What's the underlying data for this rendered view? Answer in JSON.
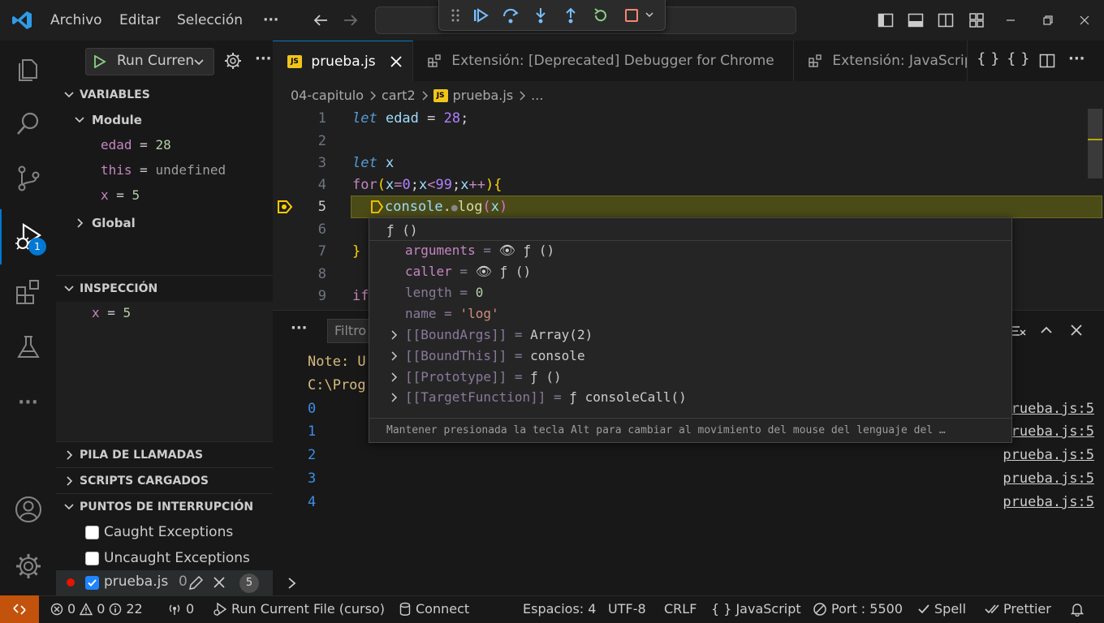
{
  "titlebar": {
    "menus": [
      "Archivo",
      "Editar",
      "Selección"
    ],
    "more": "···"
  },
  "activity": {
    "debug_badge": "1"
  },
  "sidebar": {
    "run_config": "Run Curren",
    "more": "···",
    "variables_title": "VARIABLES",
    "module_label": "Module",
    "vars": [
      {
        "name": "edad",
        "eq": " = ",
        "value": "28"
      },
      {
        "name": "this",
        "eq": " = ",
        "value": "undefined"
      },
      {
        "name": "x",
        "eq": " = ",
        "value": "5"
      }
    ],
    "global_label": "Global",
    "watch_title": "INSPECCIÓN",
    "watch": [
      {
        "name": "x",
        "eq": " = ",
        "value": "5"
      }
    ],
    "callstack_title": "PILA DE LLAMADAS",
    "scripts_title": "SCRIPTS CARGADOS",
    "breakpoints_title": "PUNTOS DE INTERRUPCIÓN",
    "breakpoints": [
      {
        "label": "Caught Exceptions",
        "checked": false
      },
      {
        "label": "Uncaught Exceptions",
        "checked": false
      }
    ],
    "bp_file": "prueba.js",
    "bp_file_num": "0",
    "bp_file_count": "5"
  },
  "tabs": [
    {
      "label": "prueba.js",
      "badge": "JS",
      "active": true
    },
    {
      "label": "Extensión: [Deprecated] Debugger for Chrome",
      "active": false
    },
    {
      "label": "Extensión: JavaScript",
      "active": false
    }
  ],
  "breadcrumb": [
    "04-capitulo",
    "cart2",
    "prueba.js",
    "..."
  ],
  "editor": {
    "line_numbers": [
      "1",
      "2",
      "3",
      "4",
      "5",
      "6",
      "7",
      "8",
      "9"
    ]
  },
  "hover": {
    "header": "ƒ ()",
    "footer": "Mantener presionada la tecla Alt para cambiar al movimiento del mouse del lenguaje del …"
  },
  "panel": {
    "more": "···",
    "filter_placeholder": "Filtro",
    "note_partial": "Note: U",
    "path_partial": "C:\\Prog",
    "outputs": [
      "0",
      "1",
      "2",
      "3",
      "4"
    ],
    "links": [
      "rueba.js:5",
      "rueba.js:5",
      "prueba.js:5",
      "prueba.js:5",
      "prueba.js:5"
    ]
  },
  "status": {
    "errors": "0",
    "warnings": "0",
    "infos": "22",
    "ports": "0",
    "run_item": "Run Current File (curso)",
    "connect": "Connect",
    "spaces": "Espacios: 4",
    "encoding": "UTF-8",
    "eol": "CRLF",
    "language": "JavaScript",
    "port": "Port : 5500",
    "spell": "Spell",
    "prettier": "Prettier"
  },
  "colors": {
    "accent": "#0078d4",
    "remote": "#c2520c",
    "current_line": "#4b4b18",
    "badge": "#0078d4"
  }
}
